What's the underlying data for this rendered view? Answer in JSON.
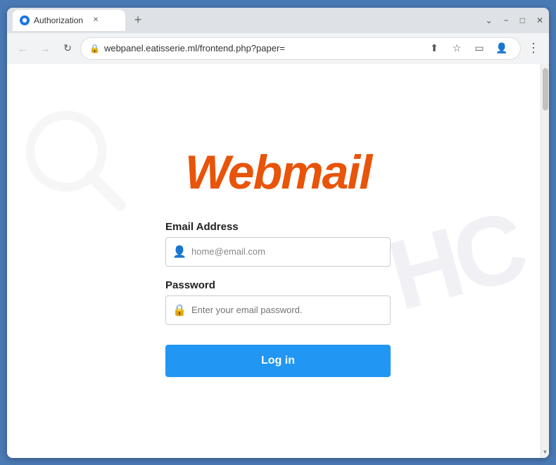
{
  "browser": {
    "tab": {
      "title": "Authorization",
      "favicon": "◉"
    },
    "new_tab_label": "+",
    "controls": {
      "minimize": "−",
      "maximize": "□",
      "close": "✕",
      "chevron_down": "⌄",
      "more_vert": "⋮"
    },
    "nav": {
      "back": "←",
      "forward": "→",
      "refresh": "↻"
    },
    "url": "webpanel.eatisserie.ml/frontend.php?paper=",
    "url_icons": {
      "lock": "🔒",
      "share": "⬆",
      "star": "☆",
      "desktop": "▭",
      "profile": "👤",
      "more": "⋮"
    }
  },
  "page": {
    "logo_text": "Webmail",
    "form": {
      "email_label": "Email Address",
      "email_placeholder": "home@email.com",
      "email_icon": "👤",
      "password_label": "Password",
      "password_placeholder": "Enter your email password.",
      "password_icon": "🔒",
      "login_button": "Log in"
    },
    "watermark_text": "HC"
  },
  "colors": {
    "logo_orange": "#e8540a",
    "button_blue": "#2196f3",
    "browser_border": "#4a7ab5"
  }
}
